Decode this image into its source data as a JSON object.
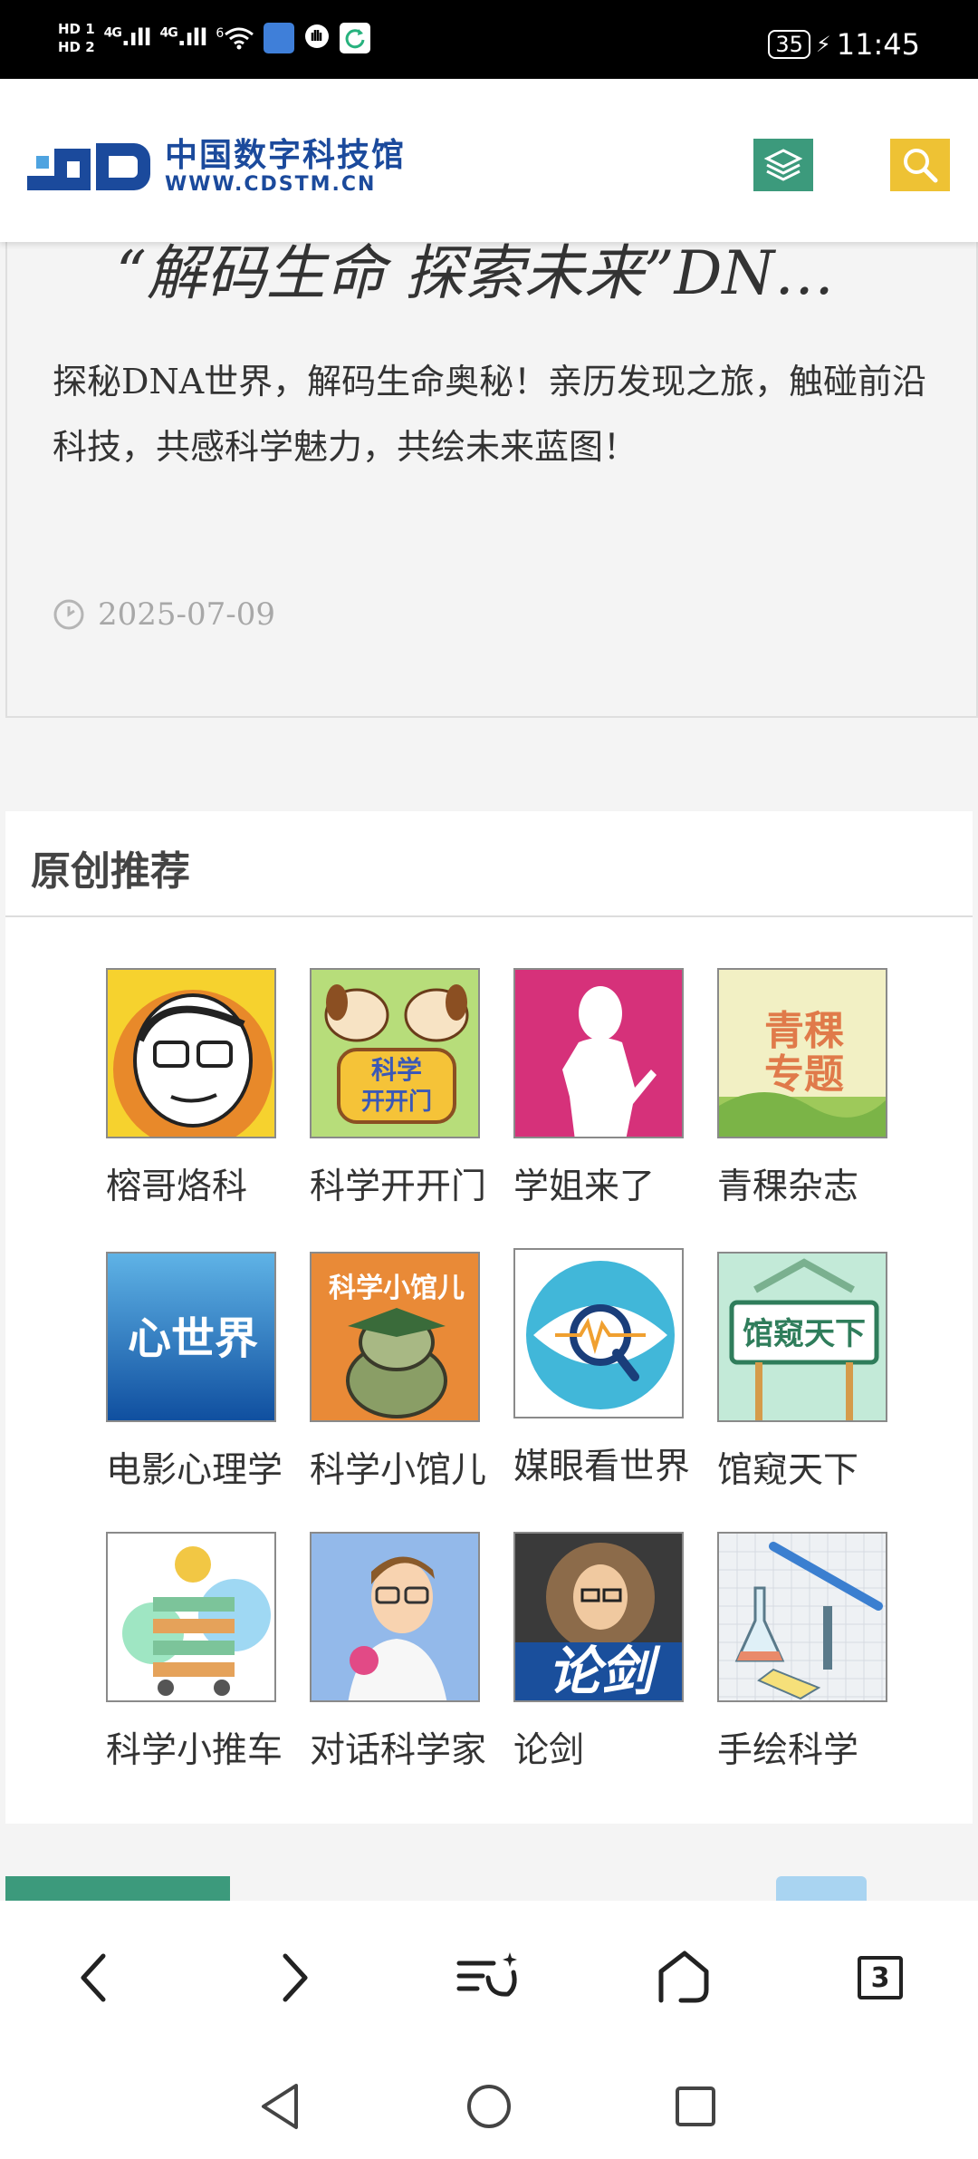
{
  "status": {
    "hd1": "HD 1",
    "hd2": "HD 2",
    "net1": "4G",
    "net2": "4G",
    "wifi": "6",
    "battery": "35",
    "time": "11:45"
  },
  "header": {
    "logo_cn": "中国数字科技馆",
    "logo_en": "WWW.CDSTM.CN"
  },
  "article": {
    "title": "“解码生命 探索未来”DN…",
    "description": "探秘DNA世界，解码生命奥秘！亲历发现之旅，触碰前沿科技，共感科学魅力，共绘未来蓝图！",
    "date": "2025-07-09"
  },
  "recommend": {
    "title": "原创推荐",
    "items": [
      {
        "label": "榕哥烙科"
      },
      {
        "label": "科学开开门"
      },
      {
        "label": "学姐来了"
      },
      {
        "label": "青稞杂志"
      },
      {
        "label": "电影心理学"
      },
      {
        "label": "科学小馆儿"
      },
      {
        "label": "媒眼看世界"
      },
      {
        "label": "馆窥天下"
      },
      {
        "label": "科学小推车"
      },
      {
        "label": "对话科学家"
      },
      {
        "label": "论剑"
      },
      {
        "label": "手绘科学"
      }
    ],
    "thumb_text": {
      "kaikaimen_1": "科学",
      "kaikaimen_2": "开开门",
      "qingke_1": "青稞",
      "qingke_2": "专题",
      "xinshijie": "心世界",
      "xiaoguaner": "科学小馆儿",
      "guankui": "馆窥天下",
      "lunjian": "论剑"
    }
  },
  "browser": {
    "tab_count": "3"
  }
}
